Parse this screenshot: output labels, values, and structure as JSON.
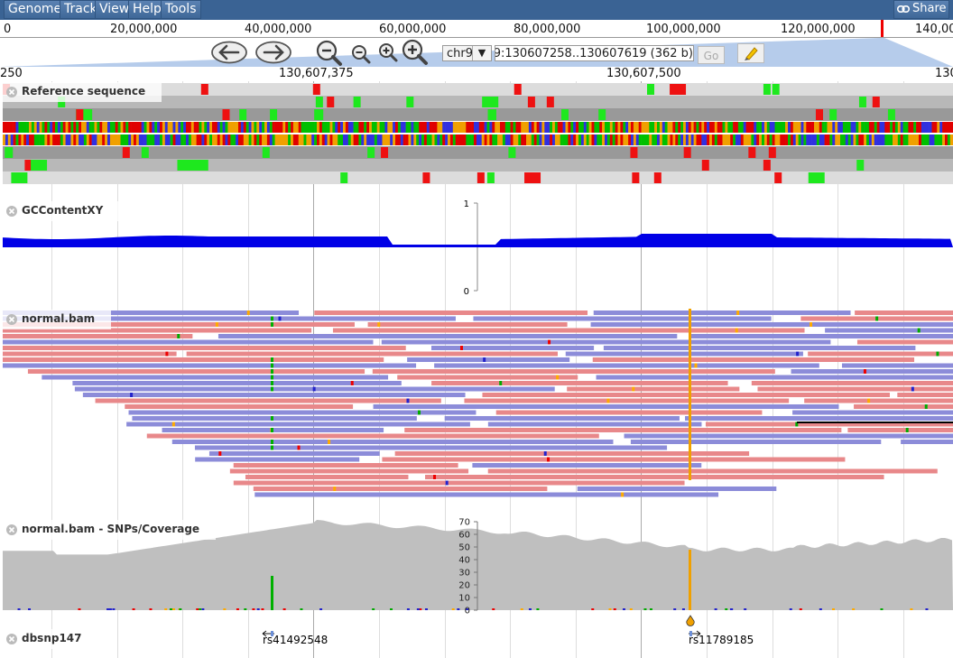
{
  "menu": {
    "items": [
      "Genome",
      "Track",
      "View",
      "Help",
      "Tools"
    ],
    "share_label": "Share"
  },
  "overview": {
    "labels": [
      "0",
      "20,000,000",
      "40,000,000",
      "60,000,000",
      "80,000,000",
      "100,000,000",
      "120,000,000",
      "140,000,000"
    ],
    "marker_color": "#ee0000"
  },
  "nav": {
    "chromosome": "chr9",
    "location": "chr9:130607258..130607619 (362 b)",
    "go_label": "Go"
  },
  "ruler": {
    "left_edge": "250",
    "labels": [
      "130,607,375",
      "130,607,500"
    ],
    "right_edge": "130"
  },
  "tracks": {
    "reference": {
      "label": "Reference sequence"
    },
    "gc": {
      "label": "GCContentXY",
      "axis_top": "1",
      "axis_bottom": "0"
    },
    "bam": {
      "label": "normal.bam"
    },
    "coverage": {
      "label": "normal.bam - SNPs/Coverage",
      "axis_ticks": [
        "70",
        "60",
        "50",
        "40",
        "30",
        "20",
        "10",
        "0"
      ]
    },
    "dbsnp": {
      "label": "dbsnp147",
      "features": [
        "rs41492548",
        "rs11789185"
      ]
    }
  },
  "colors": {
    "menu_bg": "#3a6394",
    "forward_read": "#e8888a",
    "reverse_read": "#8c8cd9",
    "gc_fill": "#0000e6",
    "coverage_fill": "#bfbfbf",
    "snp_green": "#00b000",
    "snp_orange": "#f0a000",
    "base_A": "#00c000",
    "base_C": "#3030e0",
    "base_G": "#f0a000",
    "base_T": "#e00000"
  }
}
